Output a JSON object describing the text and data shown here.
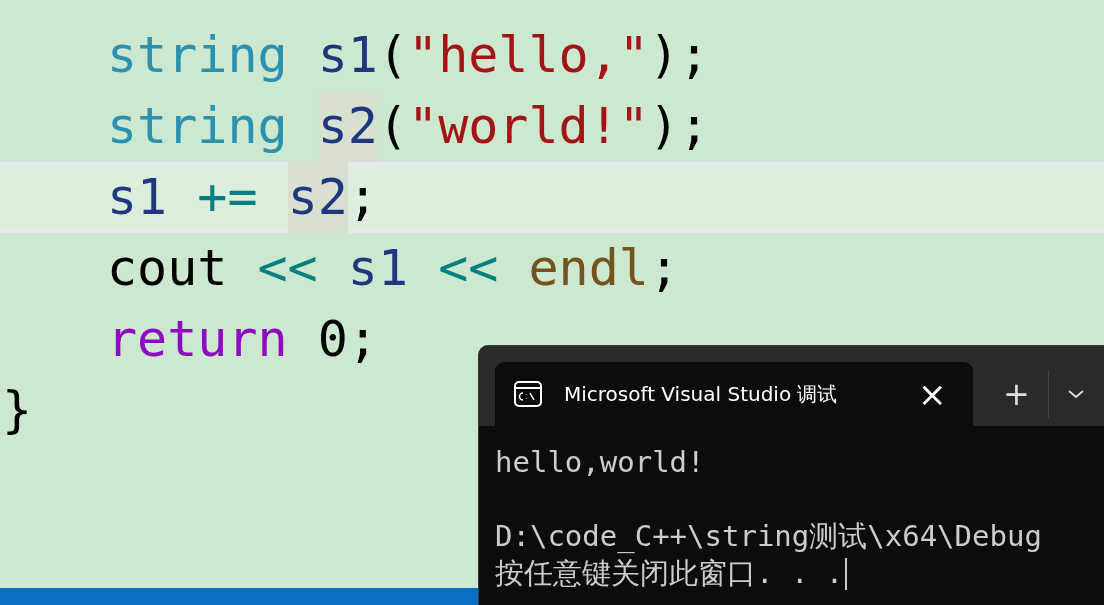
{
  "editor": {
    "body_lines": [
      {
        "current": false,
        "tokens": [
          {
            "text": "string ",
            "kind": "type",
            "highlighted": false
          },
          {
            "text": "s1",
            "kind": "variable",
            "highlighted": false
          },
          {
            "text": "(",
            "kind": "punct",
            "highlighted": false
          },
          {
            "text": "\"hello,\"",
            "kind": "string",
            "highlighted": false
          },
          {
            "text": ");",
            "kind": "punct",
            "highlighted": false
          }
        ]
      },
      {
        "current": false,
        "tokens": [
          {
            "text": "string ",
            "kind": "type",
            "highlighted": false
          },
          {
            "text": "s2",
            "kind": "variable",
            "highlighted": true
          },
          {
            "text": "(",
            "kind": "punct",
            "highlighted": false
          },
          {
            "text": "\"world!\"",
            "kind": "string",
            "highlighted": false
          },
          {
            "text": ");",
            "kind": "punct",
            "highlighted": false
          }
        ]
      },
      {
        "current": true,
        "tokens": [
          {
            "text": "s1 ",
            "kind": "variable",
            "highlighted": false
          },
          {
            "text": "+= ",
            "kind": "operator",
            "highlighted": false
          },
          {
            "text": "s2",
            "kind": "variable",
            "highlighted": true
          },
          {
            "text": ";",
            "kind": "punct",
            "highlighted": false
          }
        ]
      },
      {
        "current": false,
        "tokens": [
          {
            "text": "cout ",
            "kind": "punct",
            "highlighted": false
          },
          {
            "text": "<< ",
            "kind": "operator",
            "highlighted": false
          },
          {
            "text": "s1 ",
            "kind": "variable",
            "highlighted": false
          },
          {
            "text": "<< ",
            "kind": "operator",
            "highlighted": false
          },
          {
            "text": "endl",
            "kind": "function",
            "highlighted": false
          },
          {
            "text": ";",
            "kind": "punct",
            "highlighted": false
          }
        ]
      },
      {
        "current": false,
        "tokens": [
          {
            "text": "return ",
            "kind": "keyword",
            "highlighted": false
          },
          {
            "text": "0",
            "kind": "number",
            "highlighted": false
          },
          {
            "text": ";",
            "kind": "punct",
            "highlighted": false
          }
        ]
      }
    ],
    "closing_brace": "}"
  },
  "terminal": {
    "tab": {
      "title": "Microsoft Visual Studio 调试",
      "close": "×"
    },
    "new_tab": "+",
    "output": [
      [
        "hello,world!"
      ],
      [
        "D:\\code_C++\\string测试\\x64\\Debug",
        "按任意键关闭此窗口. . ."
      ]
    ]
  }
}
